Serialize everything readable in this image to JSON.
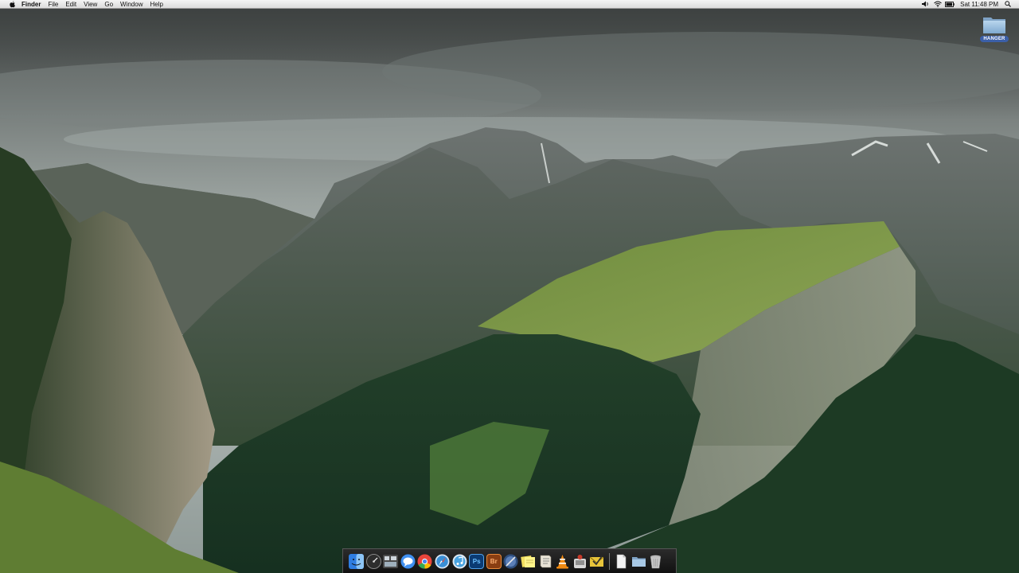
{
  "menubar": {
    "apple_icon": "apple-icon",
    "app_name": "Finder",
    "menus": [
      "File",
      "Edit",
      "View",
      "Go",
      "Window",
      "Help"
    ],
    "status_icons": [
      "volume-icon",
      "wifi-icon",
      "battery-icon"
    ],
    "clock": "Sat 11:48 PM",
    "spotlight_icon": "search-icon"
  },
  "desktop_icons": [
    {
      "label": "HANGER",
      "icon": "folder-icon"
    }
  ],
  "dock": {
    "items": [
      {
        "name": "finder",
        "icon": "finder-icon",
        "color": "#2f7de1"
      },
      {
        "name": "dashboard",
        "icon": "dashboard-icon",
        "color": "#333333"
      },
      {
        "name": "mission-control",
        "icon": "mission-control-icon",
        "color": "#6b6b6b"
      },
      {
        "name": "messages",
        "icon": "messages-icon",
        "color": "#3f8ff0"
      },
      {
        "name": "chrome",
        "icon": "chrome-icon",
        "color": "#e8453c"
      },
      {
        "name": "safari",
        "icon": "safari-icon",
        "color": "#3a8fd6"
      },
      {
        "name": "itunes",
        "icon": "itunes-icon",
        "color": "#4aa3e0"
      },
      {
        "name": "photoshop",
        "icon": "photoshop-icon",
        "label": "Ps",
        "color": "#0b3b73"
      },
      {
        "name": "bridge",
        "icon": "bridge-icon",
        "label": "Br",
        "color": "#8a3e12"
      },
      {
        "name": "xcode",
        "icon": "xcode-icon",
        "color": "#5b7fb8"
      },
      {
        "name": "stickies",
        "icon": "stickies-icon",
        "color": "#f3df60"
      },
      {
        "name": "script-editor",
        "icon": "script-icon",
        "color": "#d8d2c4"
      },
      {
        "name": "vlc",
        "icon": "vlc-icon",
        "color": "#f08a12"
      },
      {
        "name": "transmission",
        "icon": "transmission-icon",
        "color": "#c73a2a"
      },
      {
        "name": "mail-app",
        "icon": "mail-icon",
        "color": "#e8c43a"
      }
    ],
    "stack_items": [
      {
        "name": "document",
        "icon": "document-icon",
        "color": "#efefef"
      },
      {
        "name": "applications-folder",
        "icon": "folder-icon",
        "color": "#8fb4d8"
      },
      {
        "name": "trash",
        "icon": "trash-icon",
        "color": "#bfbfbf"
      }
    ]
  }
}
